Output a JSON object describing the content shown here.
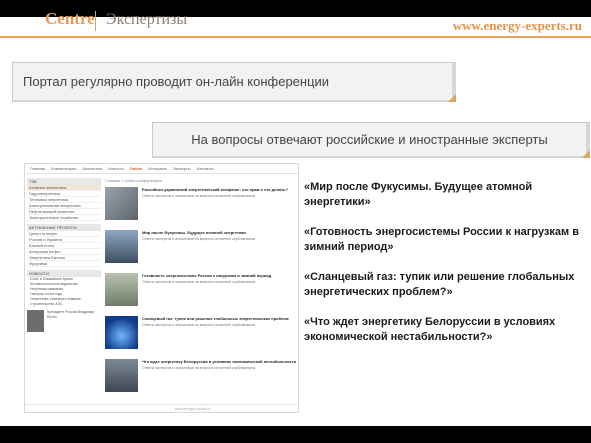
{
  "header": {
    "logo_word": "Centre",
    "logo_sub": "Экспертизы",
    "url": "www.energy-experts.ru"
  },
  "banners": {
    "top": "Портал регулярно проводит он-лайн конференции",
    "middle": "На вопросы отвечают российские и иностранные эксперты"
  },
  "screenshot": {
    "nav": [
      "Главная",
      "Комментарии",
      "Аналитика",
      "Новости",
      "Online",
      "Интерв&#39;ю",
      "Эксперты",
      "Контакты"
    ],
    "nav_active_index": 4,
    "crumb": "Главная » online-конференции",
    "side_blocks": [
      {
        "head": "ТЭК",
        "items": [
          "Атомная энергетика",
          "Гидроэнергетика",
          "Тепловая энергетика",
          "Альтернативная энергетика",
          "Нефтегазовый комплекс",
          "Электросетевое хозяйство"
        ]
      },
      {
        "head": "АКТУАЛЬНЫЕ ПРОЕКТЫ",
        "items": [
          "Цены на нефть",
          "Россия и Украина",
          "Южный поток",
          "Ангарская нефть",
          "Энергетика Балтии",
          "Фукусима"
        ]
      }
    ],
    "side_news_head": "НОВОСТИ",
    "side_news": [
      "США: в ближайшее время",
      "Антимонопольное ведомство",
      "Нефтяная кампания",
      "Газпром: итоги года",
      "Энергетика Северного Кавказа",
      "Строительство АЭС"
    ],
    "side_photo_caption": "Президент России Владимир Путин",
    "rows": [
      {
        "title": "Российско-украинский энергетический конфликт: кто прав и что делать?",
        "sub": "Ответы экспертов и аналитиков на вопросы читателей опубликованы"
      },
      {
        "title": "Мир после Фукусимы. Будущее атомной энергетики",
        "sub": "Ответы экспертов и аналитиков на вопросы читателей опубликованы"
      },
      {
        "title": "Готовность энергосистемы России к нагрузкам в зимний период",
        "sub": "Ответы экспертов и аналитиков на вопросы читателей опубликованы"
      },
      {
        "title": "Сланцевый газ: тупик или решение глобальных энергетических проблем",
        "sub": "Ответы экспертов и аналитиков на вопросы читателей опубликованы"
      },
      {
        "title": "Что ждет энергетику Белоруссии в условиях экономической нестабильности",
        "sub": "Ответы экспертов и аналитиков на вопросы читателей опубликованы"
      }
    ],
    "footer": "www.energy-experts.ru"
  },
  "questions": [
    "«Мир после Фукусимы. Будущее атомной энергетики»",
    "«Готовность энергосистемы России к нагрузкам в зимний период»",
    "«Сланцевый газ: тупик или решение глобальных энергетических проблем?»",
    "«Что ждет энергетику Белоруссии в условиях экономической нестабильности?»"
  ],
  "colors": {
    "accent": "#e3934a",
    "banner_bg": "#f2f2f2",
    "bars": "#000000"
  }
}
